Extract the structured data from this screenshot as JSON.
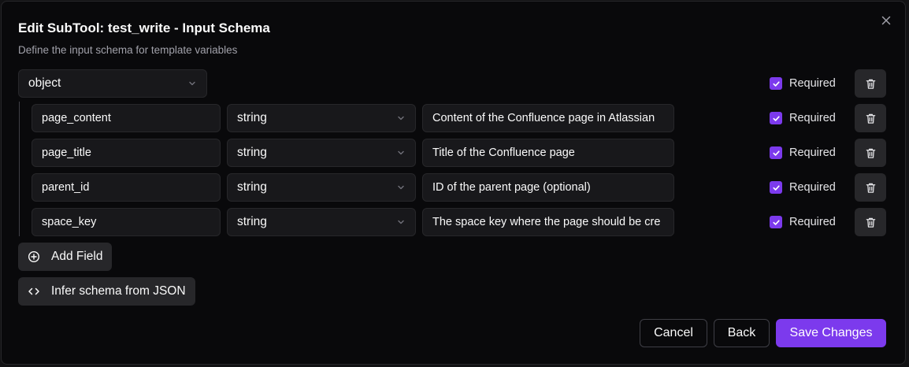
{
  "dialog": {
    "title": "Edit SubTool: test_write - Input Schema",
    "subtitle": "Define the input schema for template variables"
  },
  "root": {
    "type": "object",
    "required_label": "Required",
    "required": true
  },
  "fields": [
    {
      "name": "page_content",
      "type": "string",
      "description": "Content of the Confluence page in Atlassian",
      "required_label": "Required",
      "required": true
    },
    {
      "name": "page_title",
      "type": "string",
      "description": "Title of the Confluence page",
      "required_label": "Required",
      "required": true
    },
    {
      "name": "parent_id",
      "type": "string",
      "description": "ID of the parent page (optional)",
      "required_label": "Required",
      "required": true
    },
    {
      "name": "space_key",
      "type": "string",
      "description": "The space key where the page should be cre",
      "required_label": "Required",
      "required": true
    }
  ],
  "actions": {
    "add_field": "Add Field",
    "infer_schema": "Infer schema from JSON"
  },
  "footer": {
    "cancel": "Cancel",
    "back": "Back",
    "save": "Save Changes"
  },
  "colors": {
    "accent": "#7c3aed",
    "background": "#09090b",
    "surface": "#18181b",
    "border": "#27272a"
  }
}
